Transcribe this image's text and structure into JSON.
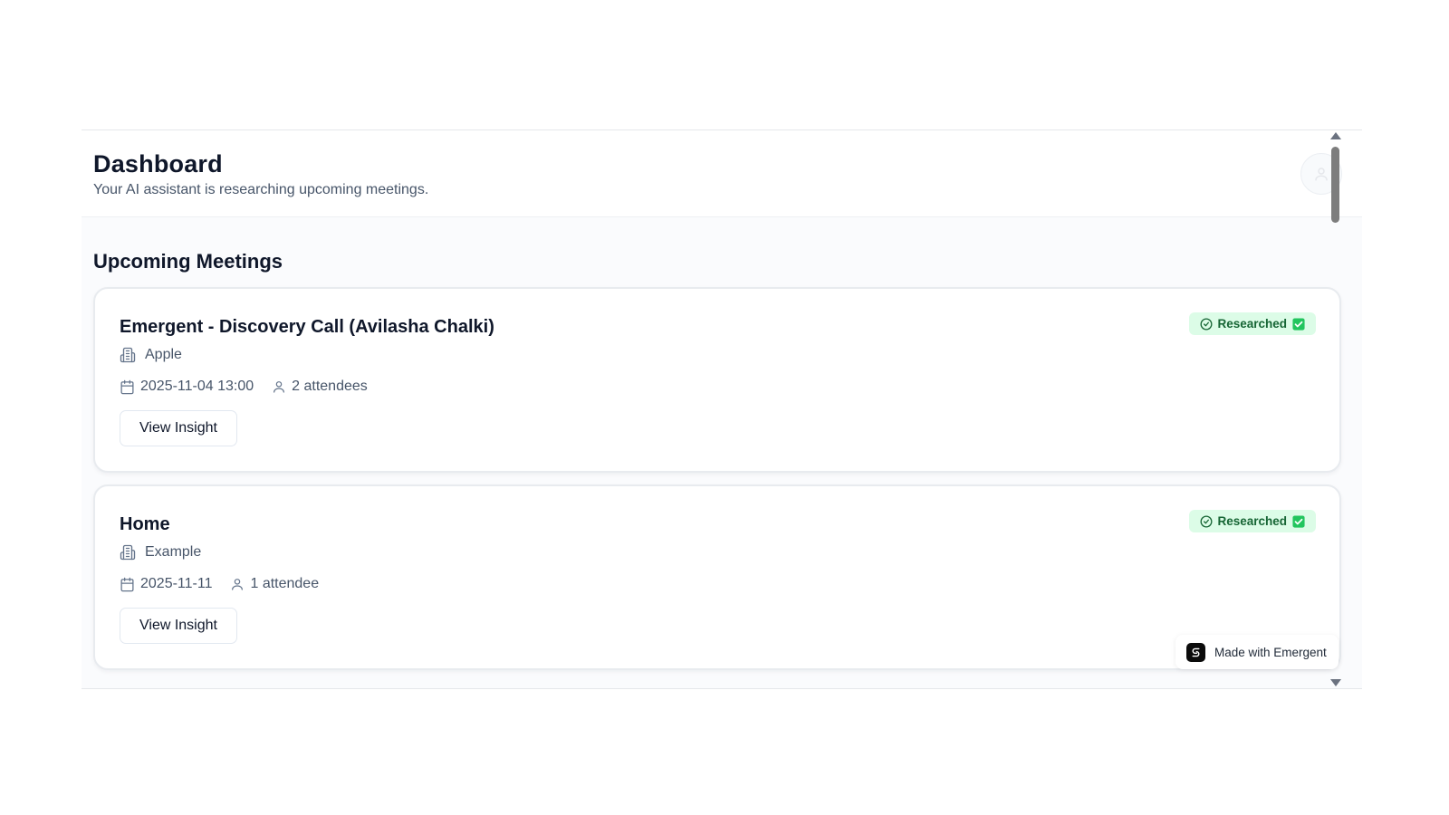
{
  "header": {
    "title": "Dashboard",
    "subtitle": "Your AI assistant is researching upcoming meetings.",
    "avatar_icon": "user-icon"
  },
  "section": {
    "title": "Upcoming Meetings"
  },
  "meetings": [
    {
      "title": "Emergent - Discovery Call (Avilasha Chalki)",
      "company": "Apple",
      "datetime": "2025-11-04 13:00",
      "attendees": "2 attendees",
      "status": "Researched",
      "button_label": "View Insight"
    },
    {
      "title": "Home",
      "company": "Example",
      "datetime": "2025-11-11",
      "attendees": "1 attendee",
      "status": "Researched",
      "button_label": "View Insight"
    }
  ],
  "badge_colors": {
    "bg": "#dcfce7",
    "text": "#166534",
    "check": "#22c55e"
  },
  "made_with": {
    "label": "Made with Emergent"
  }
}
